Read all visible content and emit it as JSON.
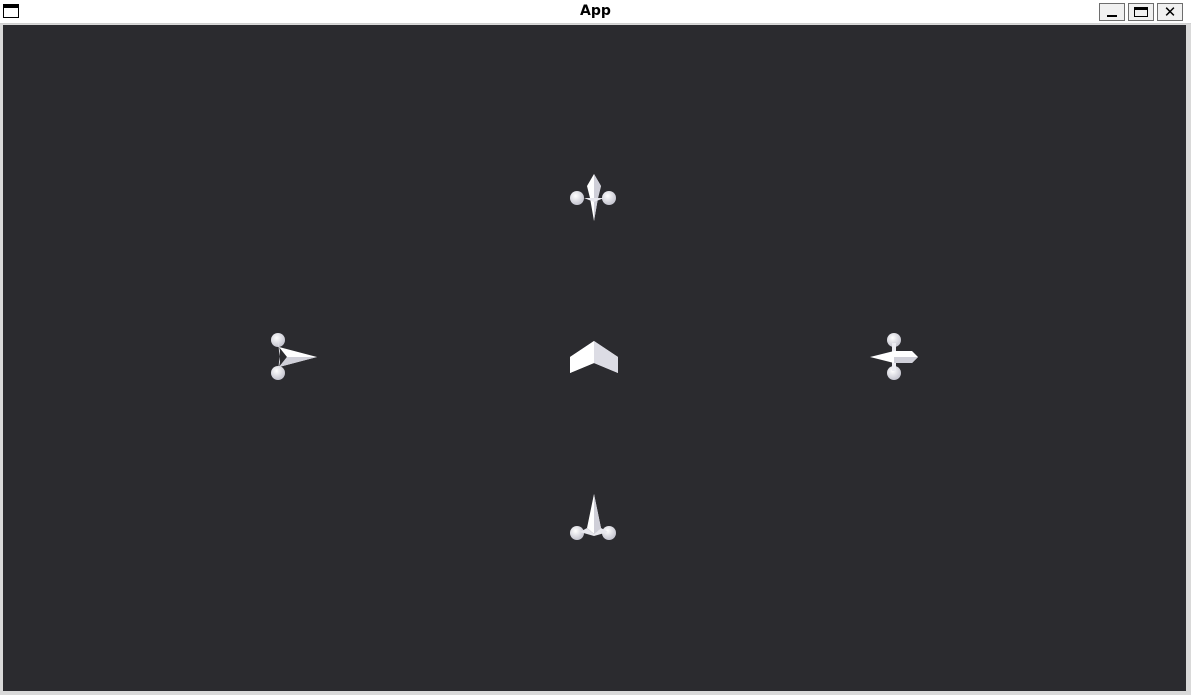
{
  "window": {
    "title": "App",
    "icon": "window-icon",
    "controls": {
      "minimize": "minimize-icon",
      "maximize": "maximize-icon",
      "close": "close-icon"
    }
  },
  "viewport": {
    "background": "#2b2b2f",
    "sprite_color": "#f2f2f6",
    "sprites": [
      {
        "name": "ship-up-icon",
        "orientation": "up"
      },
      {
        "name": "ship-left-icon",
        "orientation": "left"
      },
      {
        "name": "center-chevron-icon",
        "orientation": "center"
      },
      {
        "name": "ship-right-icon",
        "orientation": "right"
      },
      {
        "name": "ship-down-icon",
        "orientation": "down"
      }
    ]
  }
}
